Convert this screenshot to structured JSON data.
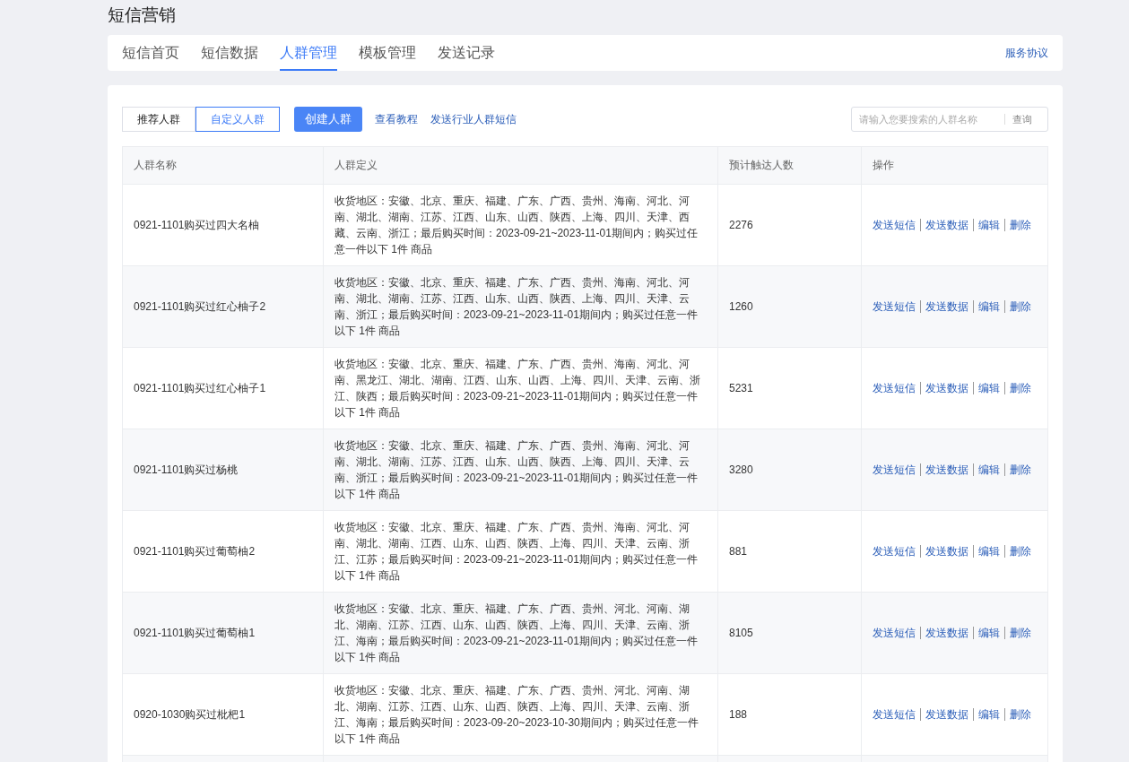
{
  "page_title": "短信营销",
  "tabs": [
    {
      "label": "短信首页",
      "selected": false
    },
    {
      "label": "短信数据",
      "selected": false
    },
    {
      "label": "人群管理",
      "selected": true
    },
    {
      "label": "模板管理",
      "selected": false
    },
    {
      "label": "发送记录",
      "selected": false
    }
  ],
  "agreement_link": "服务协议",
  "segments": [
    {
      "label": "推荐人群",
      "selected": false
    },
    {
      "label": "自定义人群",
      "selected": true
    }
  ],
  "create_button": "创建人群",
  "links": [
    "查看教程",
    "发送行业人群短信"
  ],
  "search": {
    "placeholder": "请输入您要搜索的人群名称",
    "button": "查询"
  },
  "table": {
    "columns": [
      "人群名称",
      "人群定义",
      "预计触达人数",
      "操作"
    ],
    "rows": [
      {
        "name": "0921-1101购买过四大名柚",
        "definition": "收货地区：安徽、北京、重庆、福建、广东、广西、贵州、海南、河北、河南、湖北、湖南、江苏、江西、山东、山西、陕西、上海、四川、天津、西藏、云南、浙江；最后购买时间：2023-09-21~2023-11-01期间内；购买过任意一件以下 1件 商品",
        "reach": "2276",
        "actions": [
          "发送短信",
          "发送数据",
          "编辑",
          "删除"
        ]
      },
      {
        "name": "0921-1101购买过红心柚子2",
        "definition": "收货地区：安徽、北京、重庆、福建、广东、广西、贵州、海南、河北、河南、湖北、湖南、江苏、江西、山东、山西、陕西、上海、四川、天津、云南、浙江；最后购买时间：2023-09-21~2023-11-01期间内；购买过任意一件以下 1件 商品",
        "reach": "1260",
        "actions": [
          "发送短信",
          "发送数据",
          "编辑",
          "删除"
        ]
      },
      {
        "name": "0921-1101购买过红心柚子1",
        "definition": "收货地区：安徽、北京、重庆、福建、广东、广西、贵州、海南、河北、河南、黑龙江、湖北、湖南、江西、山东、山西、上海、四川、天津、云南、浙江、陕西；最后购买时间：2023-09-21~2023-11-01期间内；购买过任意一件以下 1件 商品",
        "reach": "5231",
        "actions": [
          "发送短信",
          "发送数据",
          "编辑",
          "删除"
        ]
      },
      {
        "name": "0921-1101购买过杨桃",
        "definition": "收货地区：安徽、北京、重庆、福建、广东、广西、贵州、海南、河北、河南、湖北、湖南、江苏、江西、山东、山西、陕西、上海、四川、天津、云南、浙江；最后购买时间：2023-09-21~2023-11-01期间内；购买过任意一件以下 1件 商品",
        "reach": "3280",
        "actions": [
          "发送短信",
          "发送数据",
          "编辑",
          "删除"
        ]
      },
      {
        "name": "0921-1101购买过葡萄柚2",
        "definition": "收货地区：安徽、北京、重庆、福建、广东、广西、贵州、海南、河北、河南、湖北、湖南、江西、山东、山西、陕西、上海、四川、天津、云南、浙江、江苏；最后购买时间：2023-09-21~2023-11-01期间内；购买过任意一件以下 1件 商品",
        "reach": "881",
        "actions": [
          "发送短信",
          "发送数据",
          "编辑",
          "删除"
        ]
      },
      {
        "name": "0921-1101购买过葡萄柚1",
        "definition": "收货地区：安徽、北京、重庆、福建、广东、广西、贵州、河北、河南、湖北、湖南、江苏、江西、山东、山西、陕西、上海、四川、天津、云南、浙江、海南；最后购买时间：2023-09-21~2023-11-01期间内；购买过任意一件以下 1件 商品",
        "reach": "8105",
        "actions": [
          "发送短信",
          "发送数据",
          "编辑",
          "删除"
        ]
      },
      {
        "name": "0920-1030购买过枇杷1",
        "definition": "收货地区：安徽、北京、重庆、福建、广东、广西、贵州、河北、河南、湖北、湖南、江苏、江西、山东、山西、陕西、上海、四川、天津、云南、浙江、海南；最后购买时间：2023-09-20~2023-10-30期间内；购买过任意一件以下 1件 商品",
        "reach": "188",
        "actions": [
          "发送短信",
          "发送数据",
          "编辑",
          "删除"
        ]
      }
    ]
  }
}
